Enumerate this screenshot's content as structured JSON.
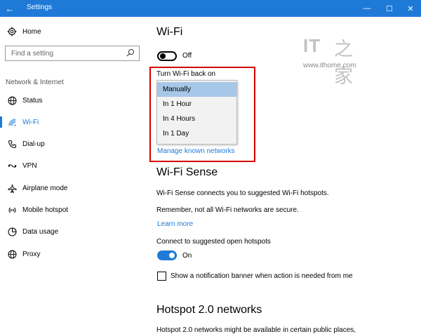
{
  "titlebar": {
    "title": "Settings",
    "back_icon": "←",
    "minimize_icon": "—",
    "maximize_icon": "☐",
    "close_icon": "✕",
    "accent": "#1e7ad6"
  },
  "sidebar": {
    "home_label": "Home",
    "search_placeholder": "Find a setting",
    "group_label": "Network & Internet",
    "items": [
      {
        "label": "Status",
        "icon": "globe-icon"
      },
      {
        "label": "Wi-Fi",
        "icon": "wifi-icon"
      },
      {
        "label": "Dial-up",
        "icon": "phone-icon"
      },
      {
        "label": "VPN",
        "icon": "vpn-icon"
      },
      {
        "label": "Airplane mode",
        "icon": "airplane-icon"
      },
      {
        "label": "Mobile hotspot",
        "icon": "hotspot-icon"
      },
      {
        "label": "Data usage",
        "icon": "pie-icon"
      },
      {
        "label": "Proxy",
        "icon": "globe-icon"
      }
    ]
  },
  "main": {
    "title": "Wi-Fi",
    "wifi_toggle_label": "Off",
    "turn_back_on_label": "Turn Wi-Fi back on",
    "dropdown_options": [
      "Manually",
      "In 1 Hour",
      "In 4 Hours",
      "In 1 Day"
    ],
    "manage_networks_link": "Manage known networks",
    "sense": {
      "title": "Wi-Fi Sense",
      "description": "Wi-Fi Sense connects you to suggested Wi-Fi hotspots.",
      "remember": "Remember, not all Wi-Fi networks are secure.",
      "learn_more": "Learn more",
      "connect_label": "Connect to suggested open hotspots",
      "connect_toggle_label": "On",
      "notification_label": "Show a notification banner when action is needed from me"
    },
    "hotspot": {
      "title": "Hotspot 2.0 networks",
      "description": "Hotspot 2.0 networks might be available in certain public places,"
    }
  },
  "watermark": {
    "logo_text": "IT",
    "logo_glyph": "之家",
    "url": "www.ithome.com"
  }
}
